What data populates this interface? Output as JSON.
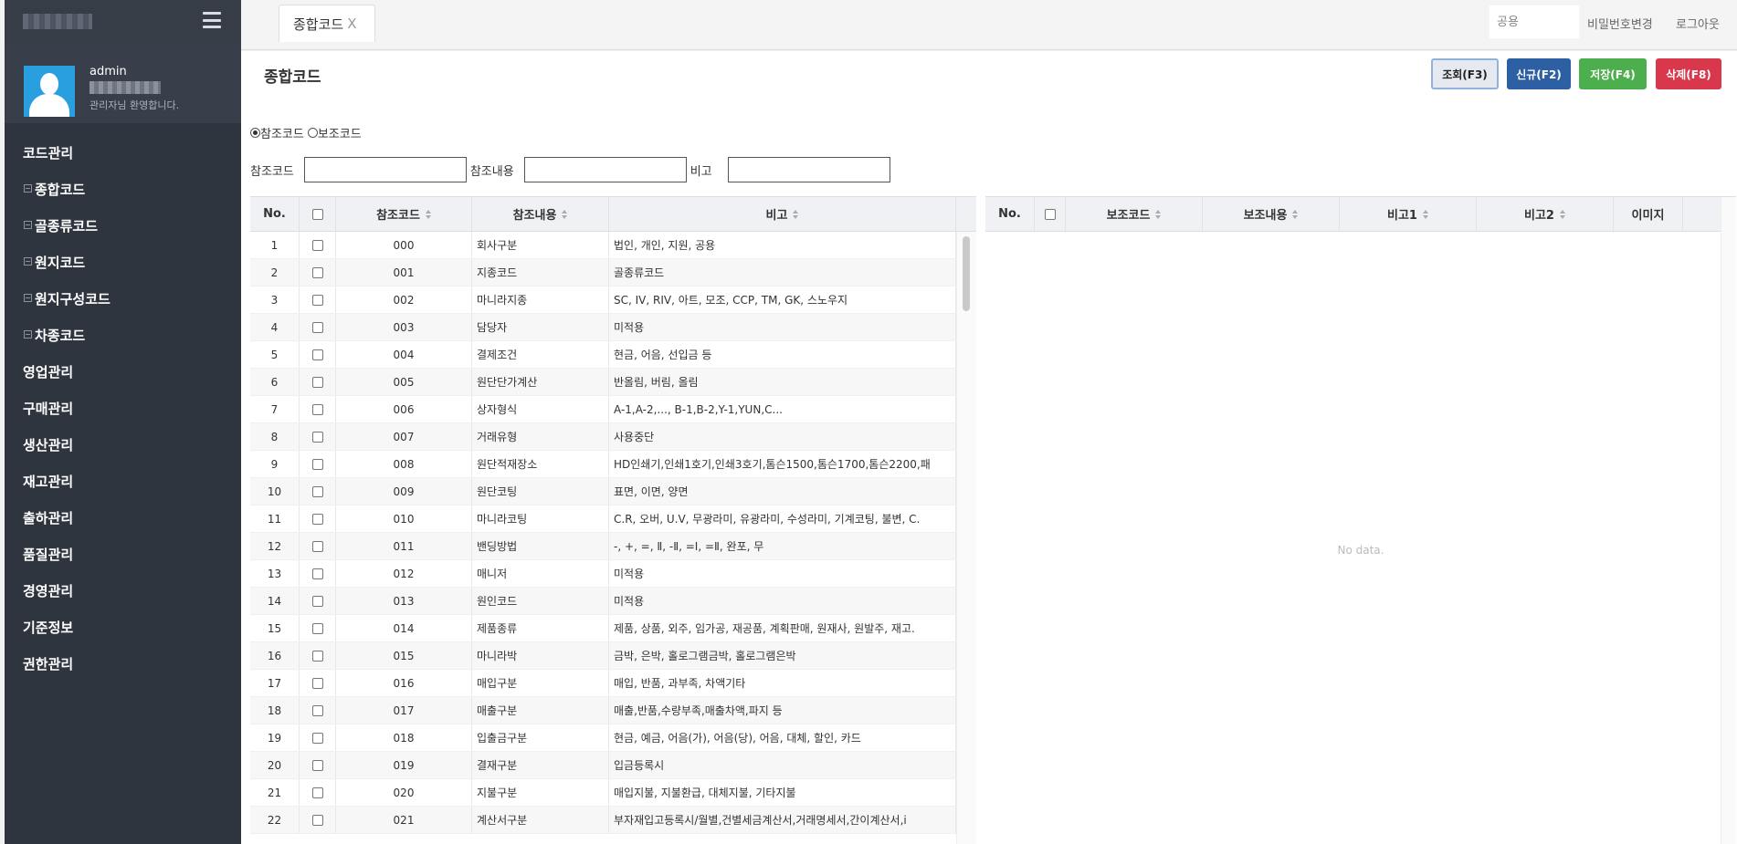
{
  "profile": {
    "name": "admin",
    "welcome": "관리자님 환영합니다."
  },
  "sidebar": {
    "items": [
      {
        "label": "코드관리"
      },
      {
        "label": "종합코드"
      },
      {
        "label": "골종류코드"
      },
      {
        "label": "원지코드"
      },
      {
        "label": "원지구성코드"
      },
      {
        "label": "차종코드"
      },
      {
        "label": "영업관리"
      },
      {
        "label": "구매관리"
      },
      {
        "label": "생산관리"
      },
      {
        "label": "재고관리"
      },
      {
        "label": "출하관리"
      },
      {
        "label": "품질관리"
      },
      {
        "label": "경영관리"
      },
      {
        "label": "기준정보"
      },
      {
        "label": "권한관리"
      }
    ]
  },
  "header": {
    "tab_label": "종합코드",
    "tab_close": "X",
    "search_placeholder": "공용",
    "change_password": "비밀번호변경",
    "logout": "로그아웃"
  },
  "page": {
    "title": "종합코드",
    "buttons": {
      "view": "조회(F3)",
      "new": "신규(F2)",
      "save": "저장(F4)",
      "delete": "삭제(F8)"
    },
    "radios": {
      "ref_code": "참조코드",
      "aux_code": "보조코드"
    },
    "filters": {
      "ref_code": "참조코드",
      "ref_content": "참조내용",
      "memo": "비고"
    }
  },
  "left_table": {
    "columns": {
      "no": "No.",
      "code": "참조코드",
      "name": "참조내용",
      "memo": "비고"
    },
    "rows": [
      {
        "no": "1",
        "code": "000",
        "name": "회사구분",
        "memo": "법인, 개인, 지원, 공용"
      },
      {
        "no": "2",
        "code": "001",
        "name": "지종코드",
        "memo": "골종류코드"
      },
      {
        "no": "3",
        "code": "002",
        "name": "마니라지종",
        "memo": "SC, IV, RIV, 아트, 모조, CCP, TM, GK, 스노우지"
      },
      {
        "no": "4",
        "code": "003",
        "name": "담당자",
        "memo": "미적용"
      },
      {
        "no": "5",
        "code": "004",
        "name": "결제조건",
        "memo": "현금, 어음, 선입금 등"
      },
      {
        "no": "6",
        "code": "005",
        "name": "원단단가계산",
        "memo": "반올림, 버림, 올림"
      },
      {
        "no": "7",
        "code": "006",
        "name": "상자형식",
        "memo": "A-1,A-2,..., B-1,B-2,Y-1,YUN,C..."
      },
      {
        "no": "8",
        "code": "007",
        "name": "거래유형",
        "memo": "사용중단"
      },
      {
        "no": "9",
        "code": "008",
        "name": "원단적재장소",
        "memo": "HD인쇄기,인쇄1호기,인쇄3호기,톰슨1500,톰슨1700,톰슨2200,패"
      },
      {
        "no": "10",
        "code": "009",
        "name": "원단코팅",
        "memo": "표면, 이면, 양면"
      },
      {
        "no": "11",
        "code": "010",
        "name": "마니라코팅",
        "memo": "C.R, 오버, U.V, 무광라미, 유광라미, 수성라미, 기계코팅, 불변, C."
      },
      {
        "no": "12",
        "code": "011",
        "name": "밴딩방법",
        "memo": "-, +, =, Ⅱ, -Ⅱ, =Ⅰ, =Ⅱ, 완포, 무"
      },
      {
        "no": "13",
        "code": "012",
        "name": "매니저",
        "memo": "미적용"
      },
      {
        "no": "14",
        "code": "013",
        "name": "원인코드",
        "memo": "미적용"
      },
      {
        "no": "15",
        "code": "014",
        "name": "제품종류",
        "memo": "제품, 상품, 외주, 임가공, 재공품, 계획판매, 원재사, 원발주, 재고."
      },
      {
        "no": "16",
        "code": "015",
        "name": "마니라박",
        "memo": "금박, 은박, 홀로그램금박, 홀로그램은박"
      },
      {
        "no": "17",
        "code": "016",
        "name": "매입구분",
        "memo": "매입, 반품, 과부족, 차액기타"
      },
      {
        "no": "18",
        "code": "017",
        "name": "매출구분",
        "memo": "매출,반품,수량부족,매출차액,파지 등"
      },
      {
        "no": "19",
        "code": "018",
        "name": "입출금구분",
        "memo": "현금, 예금, 어음(가), 어음(당), 어음, 대체, 할인, 카드"
      },
      {
        "no": "20",
        "code": "019",
        "name": "결재구분",
        "memo": "입금등록시"
      },
      {
        "no": "21",
        "code": "020",
        "name": "지불구분",
        "memo": "매입지불, 지불환급, 대체지불, 기타지불"
      },
      {
        "no": "22",
        "code": "021",
        "name": "계산서구분",
        "memo": "부자재입고등록시/월별,건별세금계산서,거래명세서,간이계산서,i"
      }
    ]
  },
  "right_table": {
    "columns": {
      "no": "No.",
      "aux_code": "보조코드",
      "aux_content": "보조내용",
      "memo1": "비고1",
      "memo2": "비고2",
      "image": "이미지"
    },
    "empty_text": "No data."
  },
  "colors": {
    "sidebar": "#2f353f",
    "btn_new": "#2d5fa3",
    "btn_save": "#4cae4c",
    "btn_delete": "#d9384c"
  }
}
